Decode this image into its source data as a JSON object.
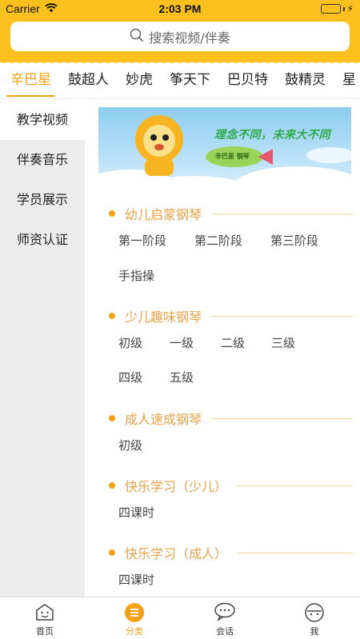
{
  "status_bar": {
    "carrier": "Carrier",
    "time": "2:03 PM"
  },
  "search": {
    "placeholder": "搜索视频/伴奏",
    "icon": "search-icon"
  },
  "tabs": [
    {
      "label": "辛巴星",
      "active": true
    },
    {
      "label": "鼓超人"
    },
    {
      "label": "妙虎"
    },
    {
      "label": "筝天下"
    },
    {
      "label": "巴贝特"
    },
    {
      "label": "鼓精灵"
    },
    {
      "label": "星"
    }
  ],
  "side_menu": [
    {
      "label": "教学视频",
      "active": true
    },
    {
      "label": "伴奏音乐"
    },
    {
      "label": "学员展示"
    },
    {
      "label": "师资认证"
    }
  ],
  "banner": {
    "slogan": "理念不同，未来大不同",
    "badge": "辛巴星 钢琴"
  },
  "sections": [
    {
      "title": "幼儿启蒙钢琴",
      "items": [
        "第一阶段",
        "第二阶段",
        "第三阶段",
        "手指操"
      ]
    },
    {
      "title": "少儿趣味钢琴",
      "items": [
        "初级",
        "一级",
        "二级",
        "三级",
        "四级",
        "五级"
      ]
    },
    {
      "title": "成人速成钢琴",
      "items": [
        "初级"
      ]
    },
    {
      "title": "快乐学习（少儿）",
      "items": [
        "四课时"
      ]
    },
    {
      "title": "快乐学习（成人）",
      "items": [
        "四课时"
      ]
    }
  ],
  "bottom_nav": [
    {
      "label": "首页",
      "icon": "home-face-icon"
    },
    {
      "label": "分类",
      "icon": "category-icon",
      "active": true
    },
    {
      "label": "会话",
      "icon": "chat-icon"
    },
    {
      "label": "我",
      "icon": "profile-icon"
    }
  ],
  "colors": {
    "brand_yellow": "#fcc01e",
    "accent_orange": "#f3a21a",
    "sidebar_bg": "#ececec"
  }
}
